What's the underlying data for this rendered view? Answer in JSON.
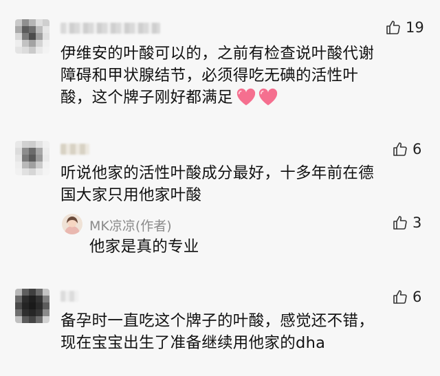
{
  "comments": [
    {
      "text_lines": [
        "伊维安的叶酸可以的，之前有检查说叶酸代谢",
        "障碍和甲状腺结节，必须得吃无碘的活性叶",
        "酸，这个牌子刚好都满足"
      ],
      "likes": "19"
    },
    {
      "text_lines": [
        "听说他家的活性叶酸成分最好，十多年前在德",
        "国大家只用他家叶酸"
      ],
      "likes": "6",
      "reply": {
        "author": "MK凉凉(作者)",
        "text": "他家是真的专业",
        "likes": "3"
      }
    },
    {
      "text_lines": [
        "备孕时一直吃这个牌子的叶酸，感觉还不错，",
        "现在宝宝出生了准备继续用他家的dha"
      ],
      "likes": "6"
    }
  ],
  "icons": {
    "like": "thumbs-up-outline-icon",
    "heart": "pink-heart-emoji"
  },
  "colors": {
    "background": "#f7f7f7",
    "text": "#111111",
    "author": "#8a8a8a",
    "heart": "#f56f8f",
    "icon_stroke": "#333333"
  }
}
